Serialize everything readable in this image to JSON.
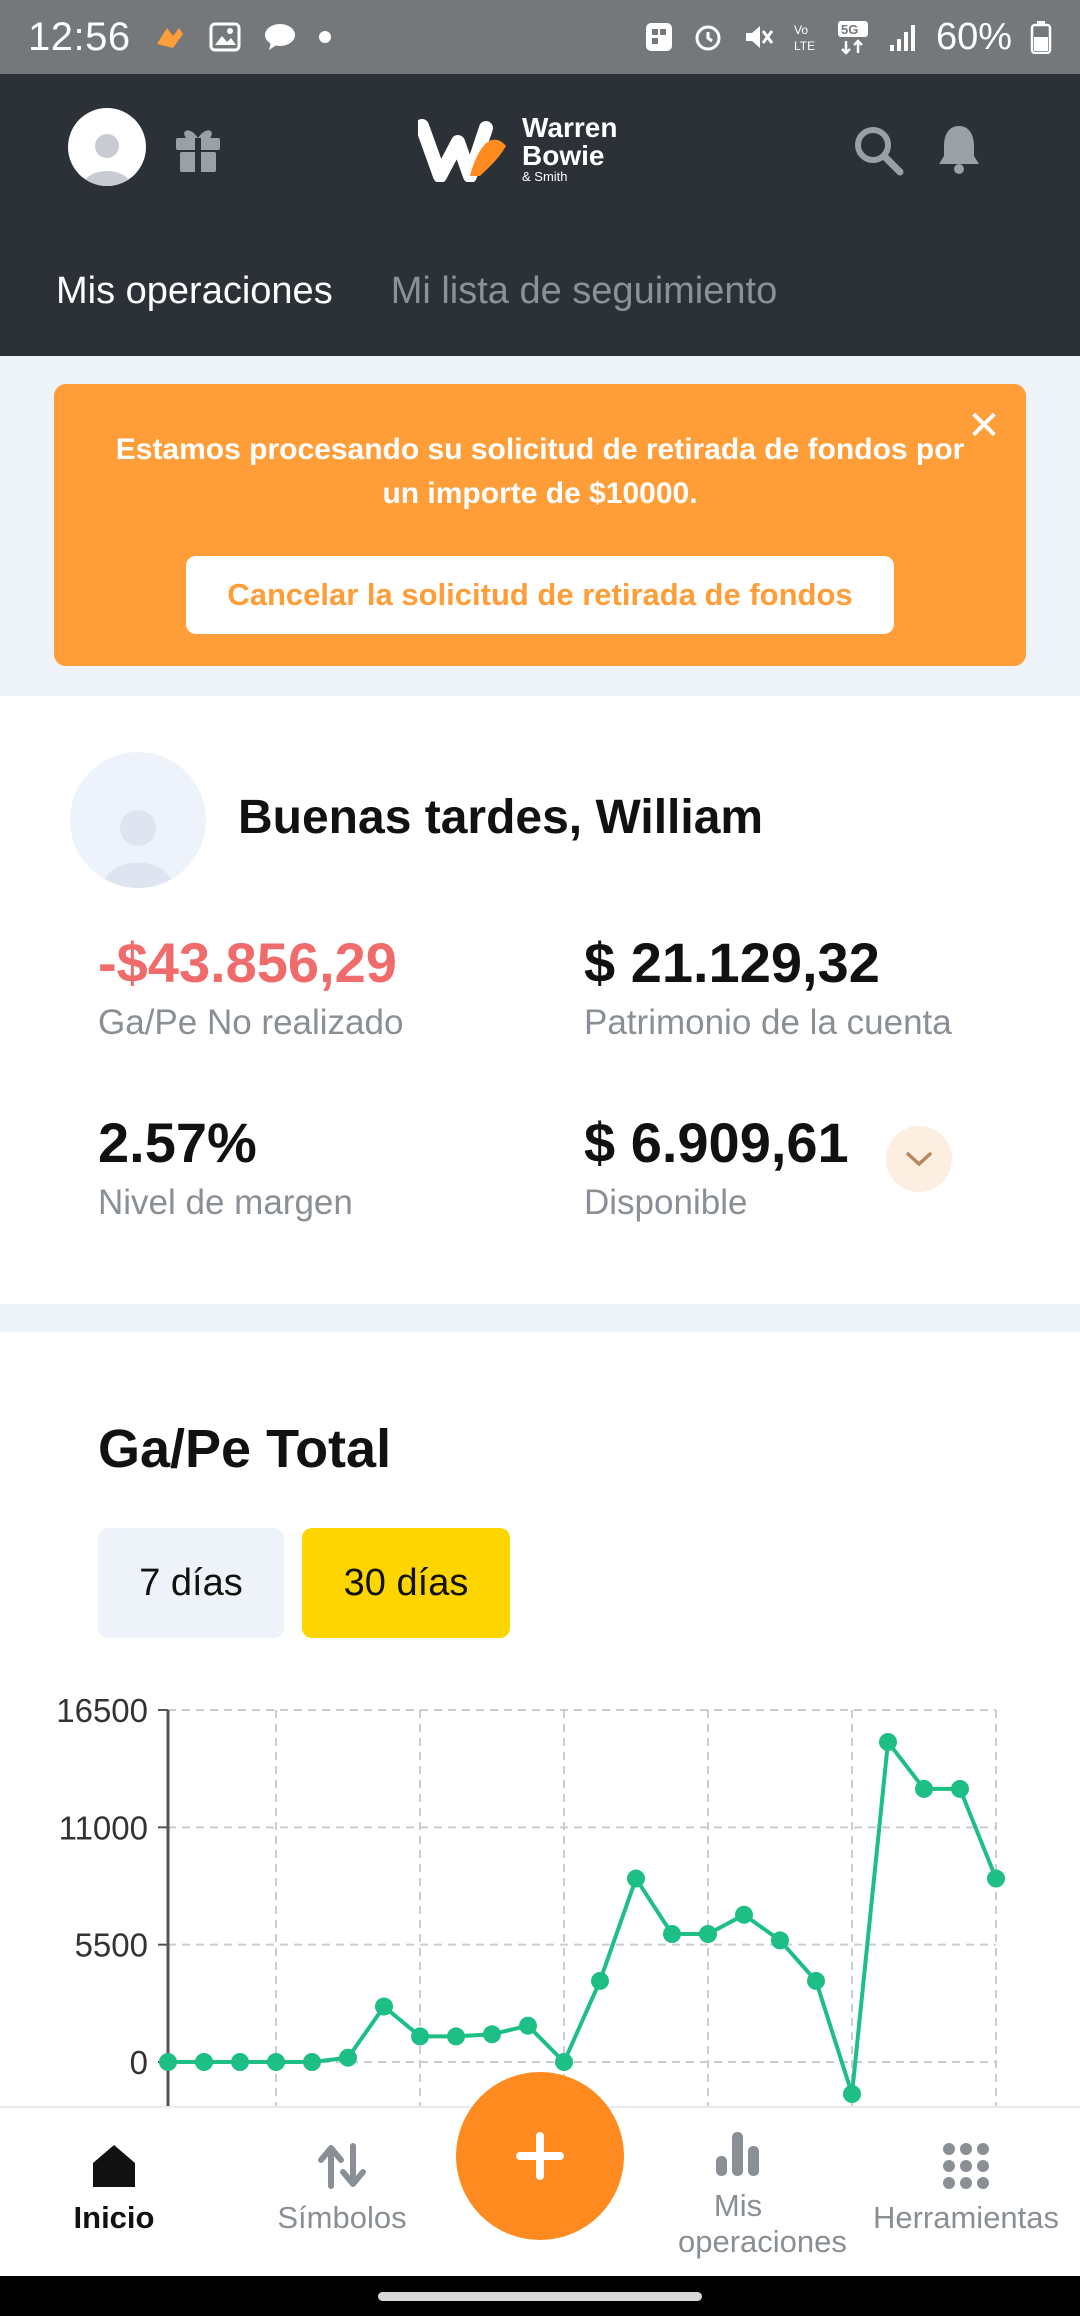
{
  "status_bar": {
    "time": "12:56",
    "battery": "60%"
  },
  "header": {
    "logo_line1": "Warren",
    "logo_line2": "Bowie",
    "logo_sub": "& Smith",
    "tabs": [
      {
        "label": "Mis operaciones",
        "active": true
      },
      {
        "label": "Mi lista de seguimiento",
        "active": false
      }
    ]
  },
  "banner": {
    "message": "Estamos procesando su solicitud de retirada de fondos por un importe de $10000.",
    "cancel_label": "Cancelar la solicitud de retirada de fondos",
    "close_icon": "close-icon",
    "color": "#ff9e38"
  },
  "account": {
    "greeting": "Buenas tardes, William",
    "stats": [
      {
        "value": "-$43.856,29",
        "label": "Ga/Pe No realizado",
        "negative": true
      },
      {
        "value": "$ 21.129,32",
        "label": "Patrimonio de la cuenta"
      },
      {
        "value": "2.57%",
        "label": "Nivel de margen"
      },
      {
        "value": "$ 6.909,61",
        "label": "Disponible"
      }
    ]
  },
  "pnl": {
    "title": "Ga/Pe Total",
    "ranges": [
      {
        "label": "7 días",
        "selected": false
      },
      {
        "label": "30 días",
        "selected": true
      }
    ]
  },
  "chart_data": {
    "type": "line",
    "title": "",
    "xlabel": "",
    "ylabel": "",
    "yticks": [
      16500,
      11000,
      5500,
      0
    ],
    "ylim": [
      -1500,
      16500
    ],
    "grid": true,
    "color": "#1dbf84",
    "values": [
      0,
      0,
      0,
      0,
      0,
      200,
      2600,
      1200,
      1200,
      1300,
      1700,
      0,
      3800,
      8600,
      6000,
      6000,
      6900,
      5700,
      3800,
      -1500,
      15000,
      12800,
      12800,
      8600
    ]
  },
  "bottom_nav": {
    "items": [
      {
        "label": "Inicio",
        "icon": "home-icon",
        "active": true
      },
      {
        "label": "Símbolos",
        "icon": "arrows-updown-icon",
        "active": false
      },
      {
        "label": "Mis operaciones",
        "icon": "bar-chart-icon",
        "active": false
      },
      {
        "label": "Herramientas",
        "icon": "grid-icon",
        "active": false
      }
    ],
    "fab_icon": "plus-icon",
    "accent": "#ff8a1f"
  }
}
